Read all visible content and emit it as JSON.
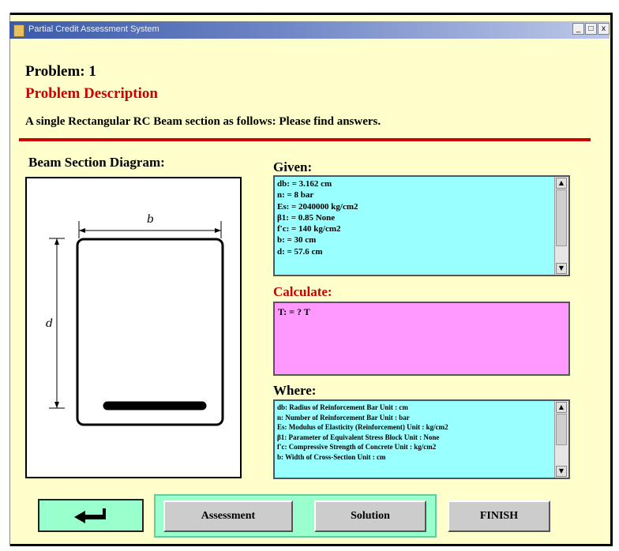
{
  "window": {
    "title": "Partial Credit Assessment System",
    "controls": [
      "_",
      "□",
      "x"
    ]
  },
  "problem": {
    "heading": "Problem: 1",
    "description_heading": "Problem Description",
    "description": "A single Rectangular RC Beam section as follows: Please find answers."
  },
  "diagram": {
    "label": "Beam Section Diagram:",
    "width_symbol": "b",
    "depth_symbol": "d"
  },
  "given": {
    "label": "Given:",
    "items": [
      "db: = 3.162 cm",
      "n: = 8 bar",
      "Es: = 2040000 kg/cm2",
      "β1: = 0.85 None",
      "f'c: = 140 kg/cm2",
      "b: = 30 cm",
      "d: = 57.6 cm"
    ]
  },
  "calculate": {
    "label": "Calculate:",
    "items": [
      "T: = ? T"
    ]
  },
  "where": {
    "label": "Where:",
    "items": [
      "db: Radius of Reinforcement Bar Unit : cm",
      "n: Number of Reinforcement Bar Unit : bar",
      "Es: Modulus of Elasticity (Reinforcement) Unit : kg/cm2",
      "β1: Parameter of Equivalent Stress Block Unit : None",
      "f'c: Compressive Strength of Concrete Unit : kg/cm2",
      "b: Width of Cross-Section Unit : cm"
    ]
  },
  "buttons": {
    "back_icon": "back-arrow-icon",
    "assessment": "Assessment",
    "solution": "Solution",
    "finish": "FINISH"
  },
  "colors": {
    "background": "#ffffcc",
    "accent_red": "#cc0000",
    "given_bg": "#99ffff",
    "calculate_bg": "#ff99ff",
    "button_group_bg": "#99ffcc"
  }
}
